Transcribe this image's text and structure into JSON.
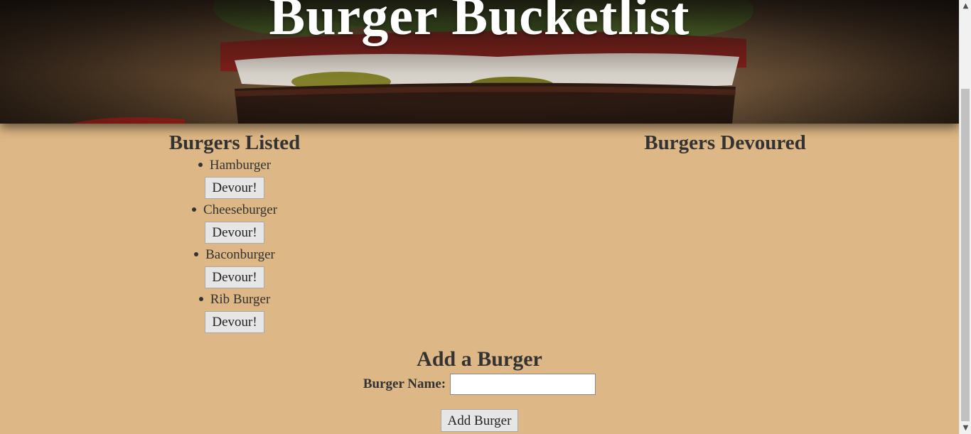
{
  "header": {
    "title": "Burger Bucketlist"
  },
  "listed": {
    "heading": "Burgers Listed",
    "items": [
      {
        "name": "Hamburger",
        "button": "Devour!"
      },
      {
        "name": "Cheeseburger",
        "button": "Devour!"
      },
      {
        "name": "Baconburger",
        "button": "Devour!"
      },
      {
        "name": "Rib Burger",
        "button": "Devour!"
      }
    ]
  },
  "devoured": {
    "heading": "Burgers Devoured",
    "items": []
  },
  "add_form": {
    "heading": "Add a Burger",
    "label": "Burger Name:",
    "input_value": "",
    "submit_label": "Add Burger"
  },
  "colors": {
    "background": "#ddb785",
    "text": "#333333",
    "title": "#ffffff"
  },
  "icons": {
    "scroll_up": "chevron-up-icon",
    "scroll_down": "chevron-down-icon",
    "bullet": "bullet-icon"
  }
}
